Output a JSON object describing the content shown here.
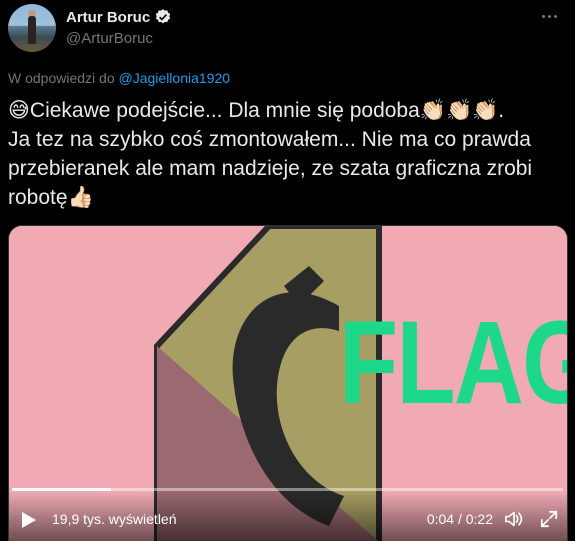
{
  "author": {
    "display_name": "Artur Boruc",
    "handle": "@ArturBoruc",
    "verified_icon": "verified-badge-icon"
  },
  "reply": {
    "prefix": "W odpowiedzi do",
    "mention": "@Jagiellonia1920"
  },
  "tweet": {
    "emoji_start": "😅",
    "line1": "Ciekawe podejście... Dla mnie się podoba",
    "clap_emoji": "👏🏻👏🏻👏🏻",
    "line1_end": ".",
    "line2": "Ja tez na szybko coś zmontowałem... Nie ma co prawda przebieranek ale mam nadzieje, ze szata graficzna zrobi robotę",
    "thumb_emoji": "👍🏻"
  },
  "video": {
    "overlay_text": "FLAG",
    "views": "19,9 tys. wyświetleń",
    "time": "0:04 / 0:22",
    "progress": 0.18,
    "colors": {
      "background": "#f1aab4",
      "shield_olive": "#a79e63",
      "shield_mauve": "#9a6a70",
      "shield_outline": "#2a2a2a",
      "flag_text": "#1ed889"
    }
  },
  "controls": {
    "play_icon": "play-icon",
    "volume_icon": "volume-icon",
    "fullscreen_icon": "fullscreen-icon",
    "more_icon": "more-options-icon"
  }
}
